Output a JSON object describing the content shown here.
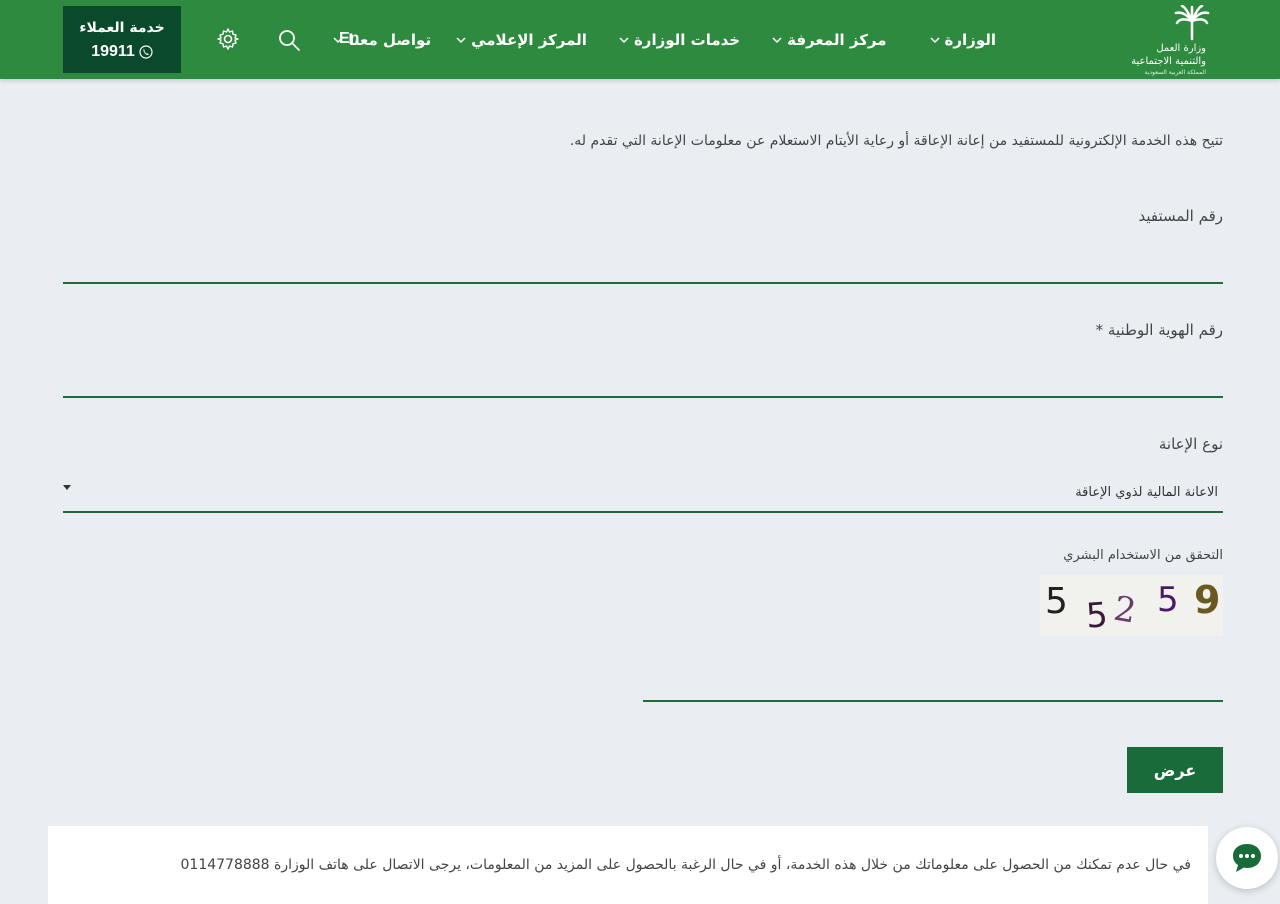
{
  "header": {
    "logo": {
      "line1": "وزارة العمل",
      "line2": "والتنمية الاجتماعية",
      "line3": "المملكة العربية السعودية",
      "icon": "palm-icon"
    },
    "nav": [
      {
        "label": "الوزارة",
        "has_dropdown": true
      },
      {
        "label": "مركز المعرفة",
        "has_dropdown": true
      },
      {
        "label": "خدمات الوزارة",
        "has_dropdown": true
      },
      {
        "label": "المركز الإعلامي",
        "has_dropdown": true
      },
      {
        "label": "تواصل معنا",
        "has_dropdown": true
      }
    ],
    "lang_label": "En",
    "customer_service": {
      "title": "خدمة العملاء",
      "phone": "19911"
    }
  },
  "main": {
    "intro": "تتيح هذه الخدمة الإلكترونية للمستفيد من إعانة الإعاقة أو رعاية الأيتام الاستعلام عن معلومات الإعانة التي تقدم له.",
    "fields": {
      "beneficiary_label": "رقم المستفيد",
      "beneficiary_value": "",
      "national_id_label": "رقم الهوية الوطنية *",
      "national_id_value": "",
      "aid_type_label": "نوع الإعانة",
      "aid_type_value": "الاعانة المالية لذوي الإعاقة"
    },
    "captcha": {
      "label": "التحقق من الاستخدام البشري",
      "chars": [
        "5",
        "5",
        "2",
        "5",
        "9"
      ],
      "input_value": ""
    },
    "submit_label": "عرض"
  },
  "notice": {
    "text": "في حال عدم تمكنك من الحصول على معلوماتك من خلال هذه الخدمة، أو في حال الرغبة بالحصول على المزيد من المعلومات، يرجى الاتصال على هاتف الوزارة 0114778888"
  },
  "colors": {
    "header_bg": "#2e8a3e",
    "cs_bg": "#0a4a2a",
    "accent": "#1a6b3a",
    "page_bg": "#eaeef2"
  }
}
